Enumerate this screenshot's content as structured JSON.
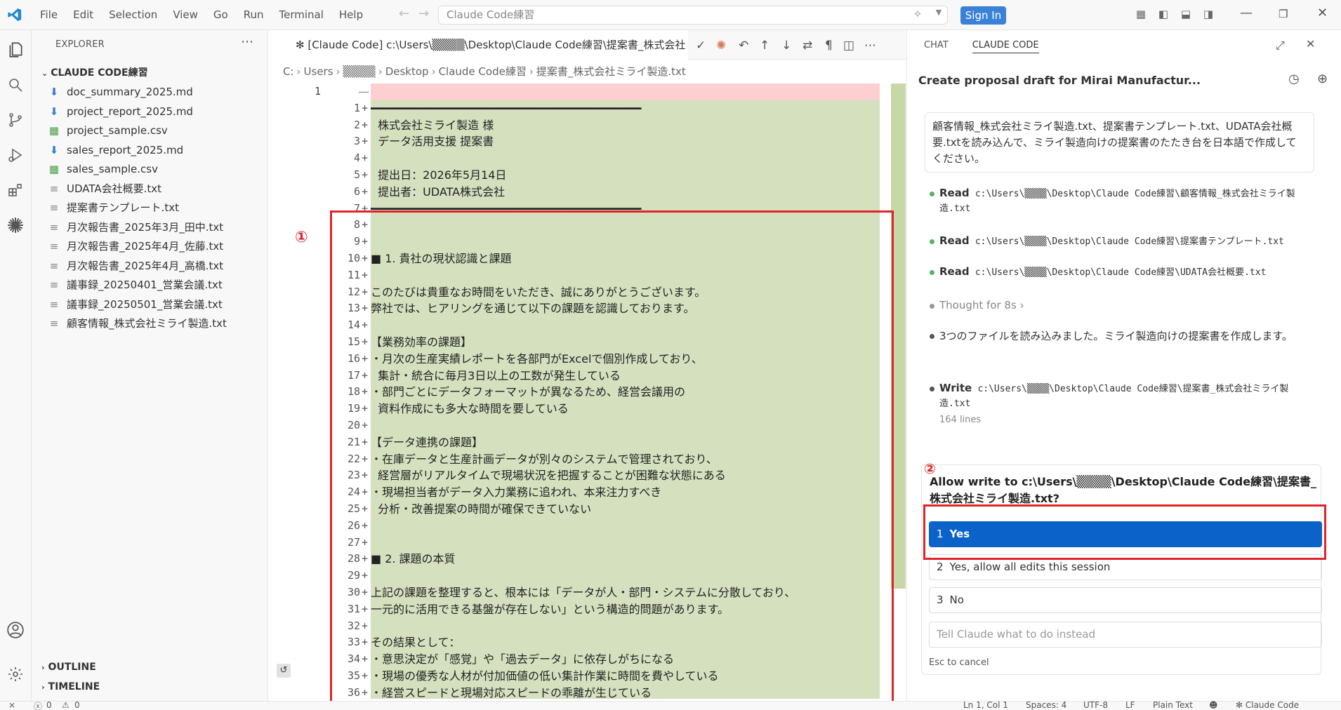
{
  "menu": {
    "file": "File",
    "edit": "Edit",
    "selection": "Selection",
    "view": "View",
    "go": "Go",
    "run": "Run",
    "terminal": "Terminal",
    "help": "Help"
  },
  "search": {
    "text": "Claude Code練習"
  },
  "signin": "Sign In",
  "explorer": {
    "header": "EXPLORER",
    "folder": "CLAUDE CODE練習",
    "files": [
      {
        "name": "doc_summary_2025.md",
        "type": "md"
      },
      {
        "name": "project_report_2025.md",
        "type": "md"
      },
      {
        "name": "project_sample.csv",
        "type": "csv"
      },
      {
        "name": "sales_report_2025.md",
        "type": "md"
      },
      {
        "name": "sales_sample.csv",
        "type": "csv"
      },
      {
        "name": "UDATA会社概要.txt",
        "type": "txt"
      },
      {
        "name": "提案書テンプレート.txt",
        "type": "txt"
      },
      {
        "name": "月次報告書_2025年3月_田中.txt",
        "type": "txt"
      },
      {
        "name": "月次報告書_2025年4月_佐藤.txt",
        "type": "txt"
      },
      {
        "name": "月次報告書_2025年4月_高橋.txt",
        "type": "txt"
      },
      {
        "name": "議事録_20250401_営業会議.txt",
        "type": "txt"
      },
      {
        "name": "議事録_20250501_営業会議.txt",
        "type": "txt"
      },
      {
        "name": "顧客情報_株式会社ミライ製造.txt",
        "type": "txt"
      }
    ],
    "outline": "OUTLINE",
    "timeline": "TIMELINE"
  },
  "editor": {
    "tab": "✻ [Claude Code] c:\\Users\\▒▒▒▒\\Desktop\\Claude Code練習\\提案書_株式会社",
    "crumbs": [
      "C:",
      "Users",
      "▒▒▒▒",
      "Desktop",
      "Claude Code練習",
      "提案書_株式会社ミライ製造.txt"
    ],
    "left_line": "1",
    "lines": [
      {
        "n": "",
        "t": "—"
      },
      {
        "n": "1",
        "t": "━━━━━━━━━━━━━━━━━━━━━━━━━━━━━━━━━━━━━━━━"
      },
      {
        "n": "2",
        "t": "  株式会社ミライ製造 様"
      },
      {
        "n": "3",
        "t": "  データ活用支援 提案書"
      },
      {
        "n": "4",
        "t": ""
      },
      {
        "n": "5",
        "t": "  提出日：2026年5月14日"
      },
      {
        "n": "6",
        "t": "  提出者：UDATA株式会社"
      },
      {
        "n": "7",
        "t": "━━━━━━━━━━━━━━━━━━━━━━━━━━━━━━━━━━━━━━━━"
      },
      {
        "n": "8",
        "t": ""
      },
      {
        "n": "9",
        "t": ""
      },
      {
        "n": "10",
        "t": "■ 1. 貴社の現状認識と課題"
      },
      {
        "n": "11",
        "t": ""
      },
      {
        "n": "12",
        "t": "このたびは貴重なお時間をいただき、誠にありがとうございます。"
      },
      {
        "n": "13",
        "t": "弊社では、ヒアリングを通じて以下の課題を認識しております。"
      },
      {
        "n": "14",
        "t": ""
      },
      {
        "n": "15",
        "t": "【業務効率の課題】"
      },
      {
        "n": "16",
        "t": "・月次の生産実績レポートを各部門がExcelで個別作成しており、"
      },
      {
        "n": "17",
        "t": "  集計・統合に毎月3日以上の工数が発生している"
      },
      {
        "n": "18",
        "t": "・部門ごとにデータフォーマットが異なるため、経営会議用の"
      },
      {
        "n": "19",
        "t": "  資料作成にも多大な時間を要している"
      },
      {
        "n": "20",
        "t": ""
      },
      {
        "n": "21",
        "t": "【データ連携の課題】"
      },
      {
        "n": "22",
        "t": "・在庫データと生産計画データが別々のシステムで管理されており、"
      },
      {
        "n": "23",
        "t": "  経営層がリアルタイムで現場状況を把握することが困難な状態にある"
      },
      {
        "n": "24",
        "t": "・現場担当者がデータ入力業務に追われ、本来注力すべき"
      },
      {
        "n": "25",
        "t": "  分析・改善提案の時間が確保できていない"
      },
      {
        "n": "26",
        "t": ""
      },
      {
        "n": "27",
        "t": ""
      },
      {
        "n": "28",
        "t": "■ 2. 課題の本質"
      },
      {
        "n": "29",
        "t": ""
      },
      {
        "n": "30",
        "t": "上記の課題を整理すると、根本には「データが人・部門・システムに分散しており、"
      },
      {
        "n": "31",
        "t": "一元的に活用できる基盤が存在しない」という構造的問題があります。"
      },
      {
        "n": "32",
        "t": ""
      },
      {
        "n": "33",
        "t": "その結果として："
      },
      {
        "n": "34",
        "t": "・意思決定が「感覚」や「過去データ」に依存しがちになる"
      },
      {
        "n": "35",
        "t": "・現場の優秀な人材が付加価値の低い集計作業に時間を費やしている"
      },
      {
        "n": "36",
        "t": "・経営スピードと現場対応スピードの乖離が生じている"
      }
    ],
    "marker1": "①",
    "marker2": "②"
  },
  "panel": {
    "tab_chat": "CHAT",
    "tab_claude": "CLAUDE CODE",
    "title": "Create proposal draft for Mirai Manufactur...",
    "prompt": "顧客情報_株式会社ミライ製造.txt、提案書テンプレート.txt、UDATA会社概要.txtを読み込んで、ミライ製造向けの提案書のたたき台を日本語で作成してください。",
    "steps": [
      {
        "label": "Read",
        "path": "c:\\Users\\▒▒▒▒\\Desktop\\Claude Code練習\\顧客情報_株式会社ミライ製造.txt"
      },
      {
        "label": "Read",
        "path": "c:\\Users\\▒▒▒▒\\Desktop\\Claude Code練習\\提案書テンプレート.txt"
      },
      {
        "label": "Read",
        "path": "c:\\Users\\▒▒▒▒\\Desktop\\Claude Code練習\\UDATA会社概要.txt"
      }
    ],
    "thought": "Thought for 8s",
    "message": "3つのファイルを読み込みました。ミライ製造向けの提案書を作成します。",
    "write": {
      "label": "Write",
      "path": "c:\\Users\\▒▒▒▒\\Desktop\\Claude Code練習\\提案書_株式会社ミライ製造.txt",
      "lines": "164 lines"
    },
    "allow": "Allow write to c:\\Users\\▒▒▒▒\\Desktop\\Claude Code練習\\提案書_株式会社ミライ製造.txt?",
    "options": [
      {
        "n": "1",
        "label": "Yes"
      },
      {
        "n": "2",
        "label": "Yes, allow all edits this session"
      },
      {
        "n": "3",
        "label": "No"
      }
    ],
    "instead_placeholder": "Tell Claude what to do instead",
    "esc": "Esc to cancel"
  },
  "status": {
    "errors": "0",
    "warnings": "0",
    "position": "Ln 1, Col 1",
    "spaces": "Spaces: 4",
    "encoding": "UTF-8",
    "eol": "LF",
    "lang": "Plain Text",
    "claude": "✻ Claude Code"
  },
  "colors": {
    "accent": "#0b62c9",
    "added": "#d5e0bf",
    "removed": "#fcd0d0",
    "annotation": "#e0242a"
  }
}
